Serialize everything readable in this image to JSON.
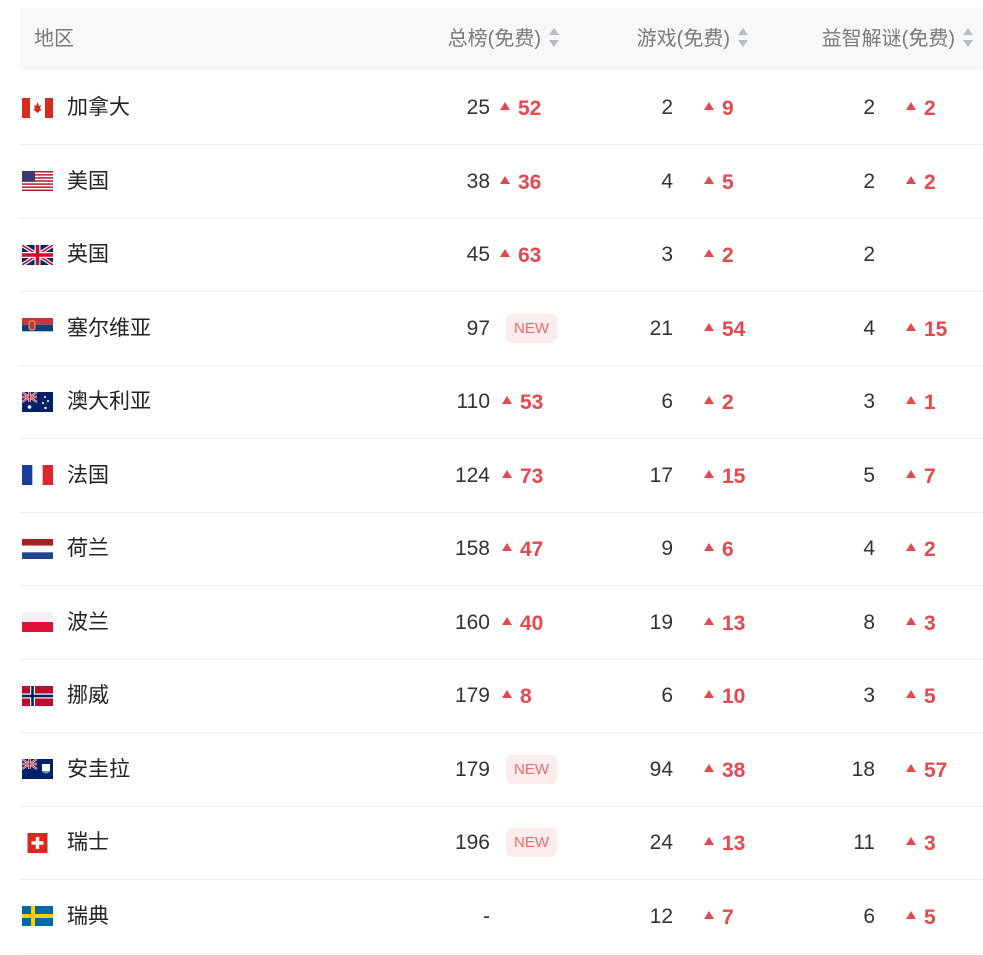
{
  "header": {
    "region": "地区",
    "overall": "总榜(免费)",
    "games": "游戏(免费)",
    "puzzle": "益智解谜(免费)"
  },
  "rows": [
    {
      "name": "加拿大",
      "flag": "canada-flag-icon",
      "overall": "25",
      "overall_chg": "52",
      "games": "2",
      "games_chg": "9",
      "puzzle": "2",
      "puzzle_chg": "2"
    },
    {
      "name": "美国",
      "flag": "usa-flag-icon",
      "overall": "38",
      "overall_chg": "36",
      "games": "4",
      "games_chg": "5",
      "puzzle": "2",
      "puzzle_chg": "2"
    },
    {
      "name": "英国",
      "flag": "uk-flag-icon",
      "overall": "45",
      "overall_chg": "63",
      "games": "3",
      "games_chg": "2",
      "puzzle": "2",
      "puzzle_chg": ""
    },
    {
      "name": "塞尔维亚",
      "flag": "serbia-flag-icon",
      "overall": "97",
      "overall_new": "NEW",
      "games": "21",
      "games_chg": "54",
      "puzzle": "4",
      "puzzle_chg": "15"
    },
    {
      "name": "澳大利亚",
      "flag": "australia-flag-icon",
      "overall": "110",
      "overall_chg": "53",
      "games": "6",
      "games_chg": "2",
      "puzzle": "3",
      "puzzle_chg": "1"
    },
    {
      "name": "法国",
      "flag": "france-flag-icon",
      "overall": "124",
      "overall_chg": "73",
      "games": "17",
      "games_chg": "15",
      "puzzle": "5",
      "puzzle_chg": "7"
    },
    {
      "name": "荷兰",
      "flag": "netherlands-flag-icon",
      "overall": "158",
      "overall_chg": "47",
      "games": "9",
      "games_chg": "6",
      "puzzle": "4",
      "puzzle_chg": "2"
    },
    {
      "name": "波兰",
      "flag": "poland-flag-icon",
      "overall": "160",
      "overall_chg": "40",
      "games": "19",
      "games_chg": "13",
      "puzzle": "8",
      "puzzle_chg": "3"
    },
    {
      "name": "挪威",
      "flag": "norway-flag-icon",
      "overall": "179",
      "overall_chg": "8",
      "games": "6",
      "games_chg": "10",
      "puzzle": "3",
      "puzzle_chg": "5"
    },
    {
      "name": "安圭拉",
      "flag": "anguilla-flag-icon",
      "overall": "179",
      "overall_new": "NEW",
      "games": "94",
      "games_chg": "38",
      "puzzle": "18",
      "puzzle_chg": "57"
    },
    {
      "name": "瑞士",
      "flag": "switzerland-flag-icon",
      "overall": "196",
      "overall_new": "NEW",
      "games": "24",
      "games_chg": "13",
      "puzzle": "11",
      "puzzle_chg": "3"
    },
    {
      "name": "瑞典",
      "flag": "sweden-flag-icon",
      "overall": "-",
      "games": "12",
      "games_chg": "7",
      "puzzle": "6",
      "puzzle_chg": "5"
    }
  ],
  "colors": {
    "up": "#e5484d",
    "new_bg": "#fdecec",
    "new_text": "#ec6b6b",
    "header_bg": "#f7f8fa"
  }
}
